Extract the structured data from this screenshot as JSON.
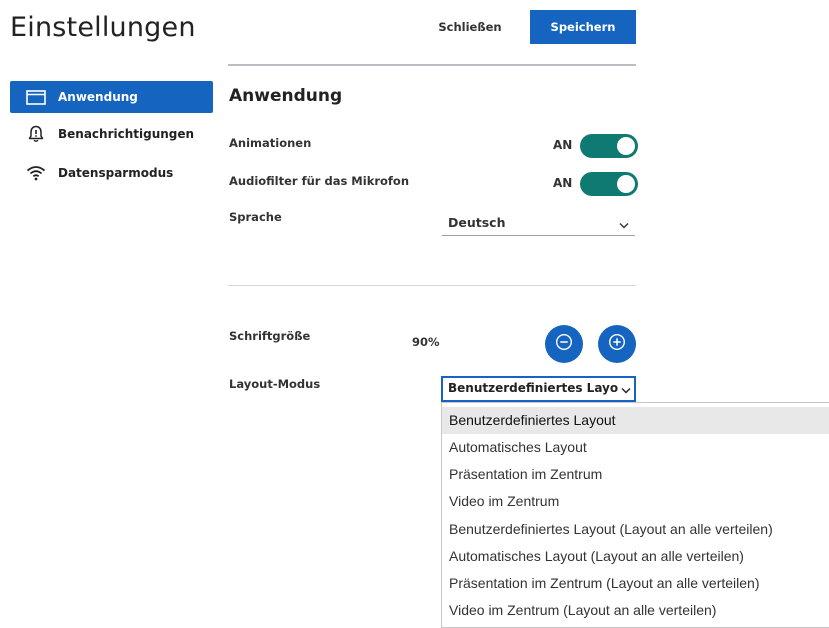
{
  "header": {
    "title": "Einstellungen",
    "close_label": "Schließen",
    "save_label": "Speichern"
  },
  "sidebar": {
    "items": [
      {
        "label": "Anwendung",
        "icon": "window-icon",
        "active": true
      },
      {
        "label": "Benachrichtigungen",
        "icon": "bell-alert-icon",
        "active": false
      },
      {
        "label": "Datensparmodus",
        "icon": "wifi-icon",
        "active": false
      }
    ]
  },
  "main": {
    "section_title": "Anwendung",
    "settings": {
      "animations": {
        "label": "Animationen",
        "state": "AN"
      },
      "audio_filter": {
        "label": "Audiofilter für das Mikrofon",
        "state": "AN"
      },
      "language": {
        "label": "Sprache",
        "value": "Deutsch"
      },
      "font_size": {
        "label": "Schriftgröße",
        "value": "90%"
      },
      "layout_mode": {
        "label": "Layout-Modus",
        "value": "Benutzerdefiniertes Layout",
        "options": [
          "Benutzerdefiniertes Layout",
          "Automatisches Layout",
          "Präsentation im Zentrum",
          "Video im Zentrum",
          "Benutzerdefiniertes Layout (Layout an alle verteilen)",
          "Automatisches Layout (Layout an alle verteilen)",
          "Präsentation im Zentrum (Layout an alle verteilen)",
          "Video im Zentrum (Layout an alle verteilen)"
        ],
        "selected_index": 0
      }
    }
  },
  "colors": {
    "accent": "#1565c0",
    "toggle_on": "#0e7a72"
  }
}
